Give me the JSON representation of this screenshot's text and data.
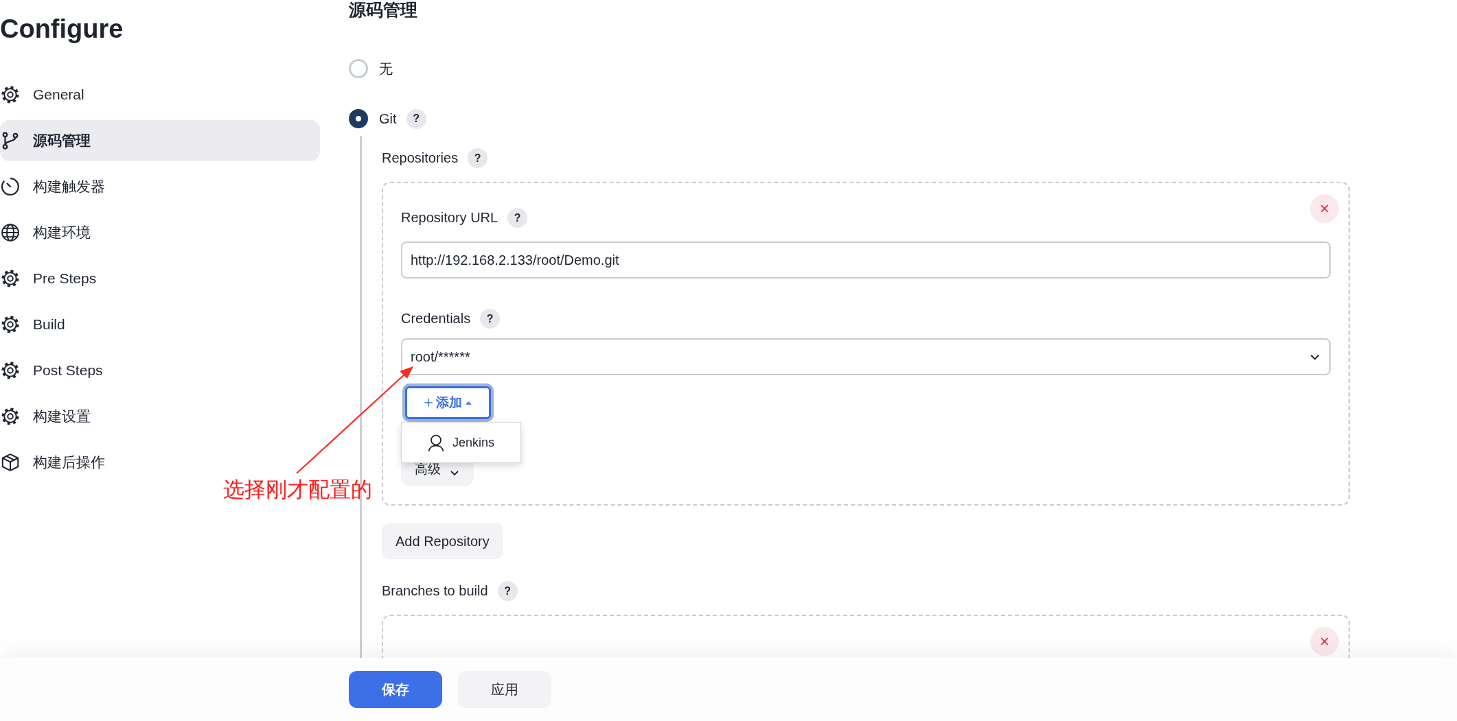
{
  "page_title": "Configure",
  "sidebar": {
    "items": [
      {
        "label": "General",
        "kind": "gear",
        "selected": false
      },
      {
        "label": "源码管理",
        "kind": "branch",
        "selected": true
      },
      {
        "label": "构建触发器",
        "kind": "timer",
        "selected": false
      },
      {
        "label": "构建环境",
        "kind": "globe",
        "selected": false
      },
      {
        "label": "Pre Steps",
        "kind": "gear",
        "selected": false
      },
      {
        "label": "Build",
        "kind": "gear",
        "selected": false
      },
      {
        "label": "Post Steps",
        "kind": "gear",
        "selected": false
      },
      {
        "label": "构建设置",
        "kind": "gear",
        "selected": false
      },
      {
        "label": "构建后操作",
        "kind": "package",
        "selected": false
      }
    ]
  },
  "section": {
    "title": "源码管理",
    "options": [
      {
        "label": "无",
        "selected": false
      },
      {
        "label": "Git",
        "selected": true,
        "help": "?"
      }
    ]
  },
  "git": {
    "repositories_label": "Repositories",
    "repositories_help": "?",
    "repository": {
      "url_label": "Repository URL",
      "url_help": "?",
      "url_value": "http://192.168.2.133/root/Demo.git",
      "credentials_label": "Credentials",
      "credentials_help": "?",
      "credentials_value": "root/******",
      "add_button": "添加",
      "add_menu": {
        "expanded": true,
        "items": [
          {
            "label": "Jenkins"
          }
        ]
      },
      "advanced_button": "高级"
    },
    "add_repository_button": "Add Repository",
    "branches_label": "Branches to build",
    "branches_help": "?"
  },
  "annotation": {
    "text": "选择刚才配置的"
  },
  "footer": {
    "save": "保存",
    "apply": "应用"
  }
}
